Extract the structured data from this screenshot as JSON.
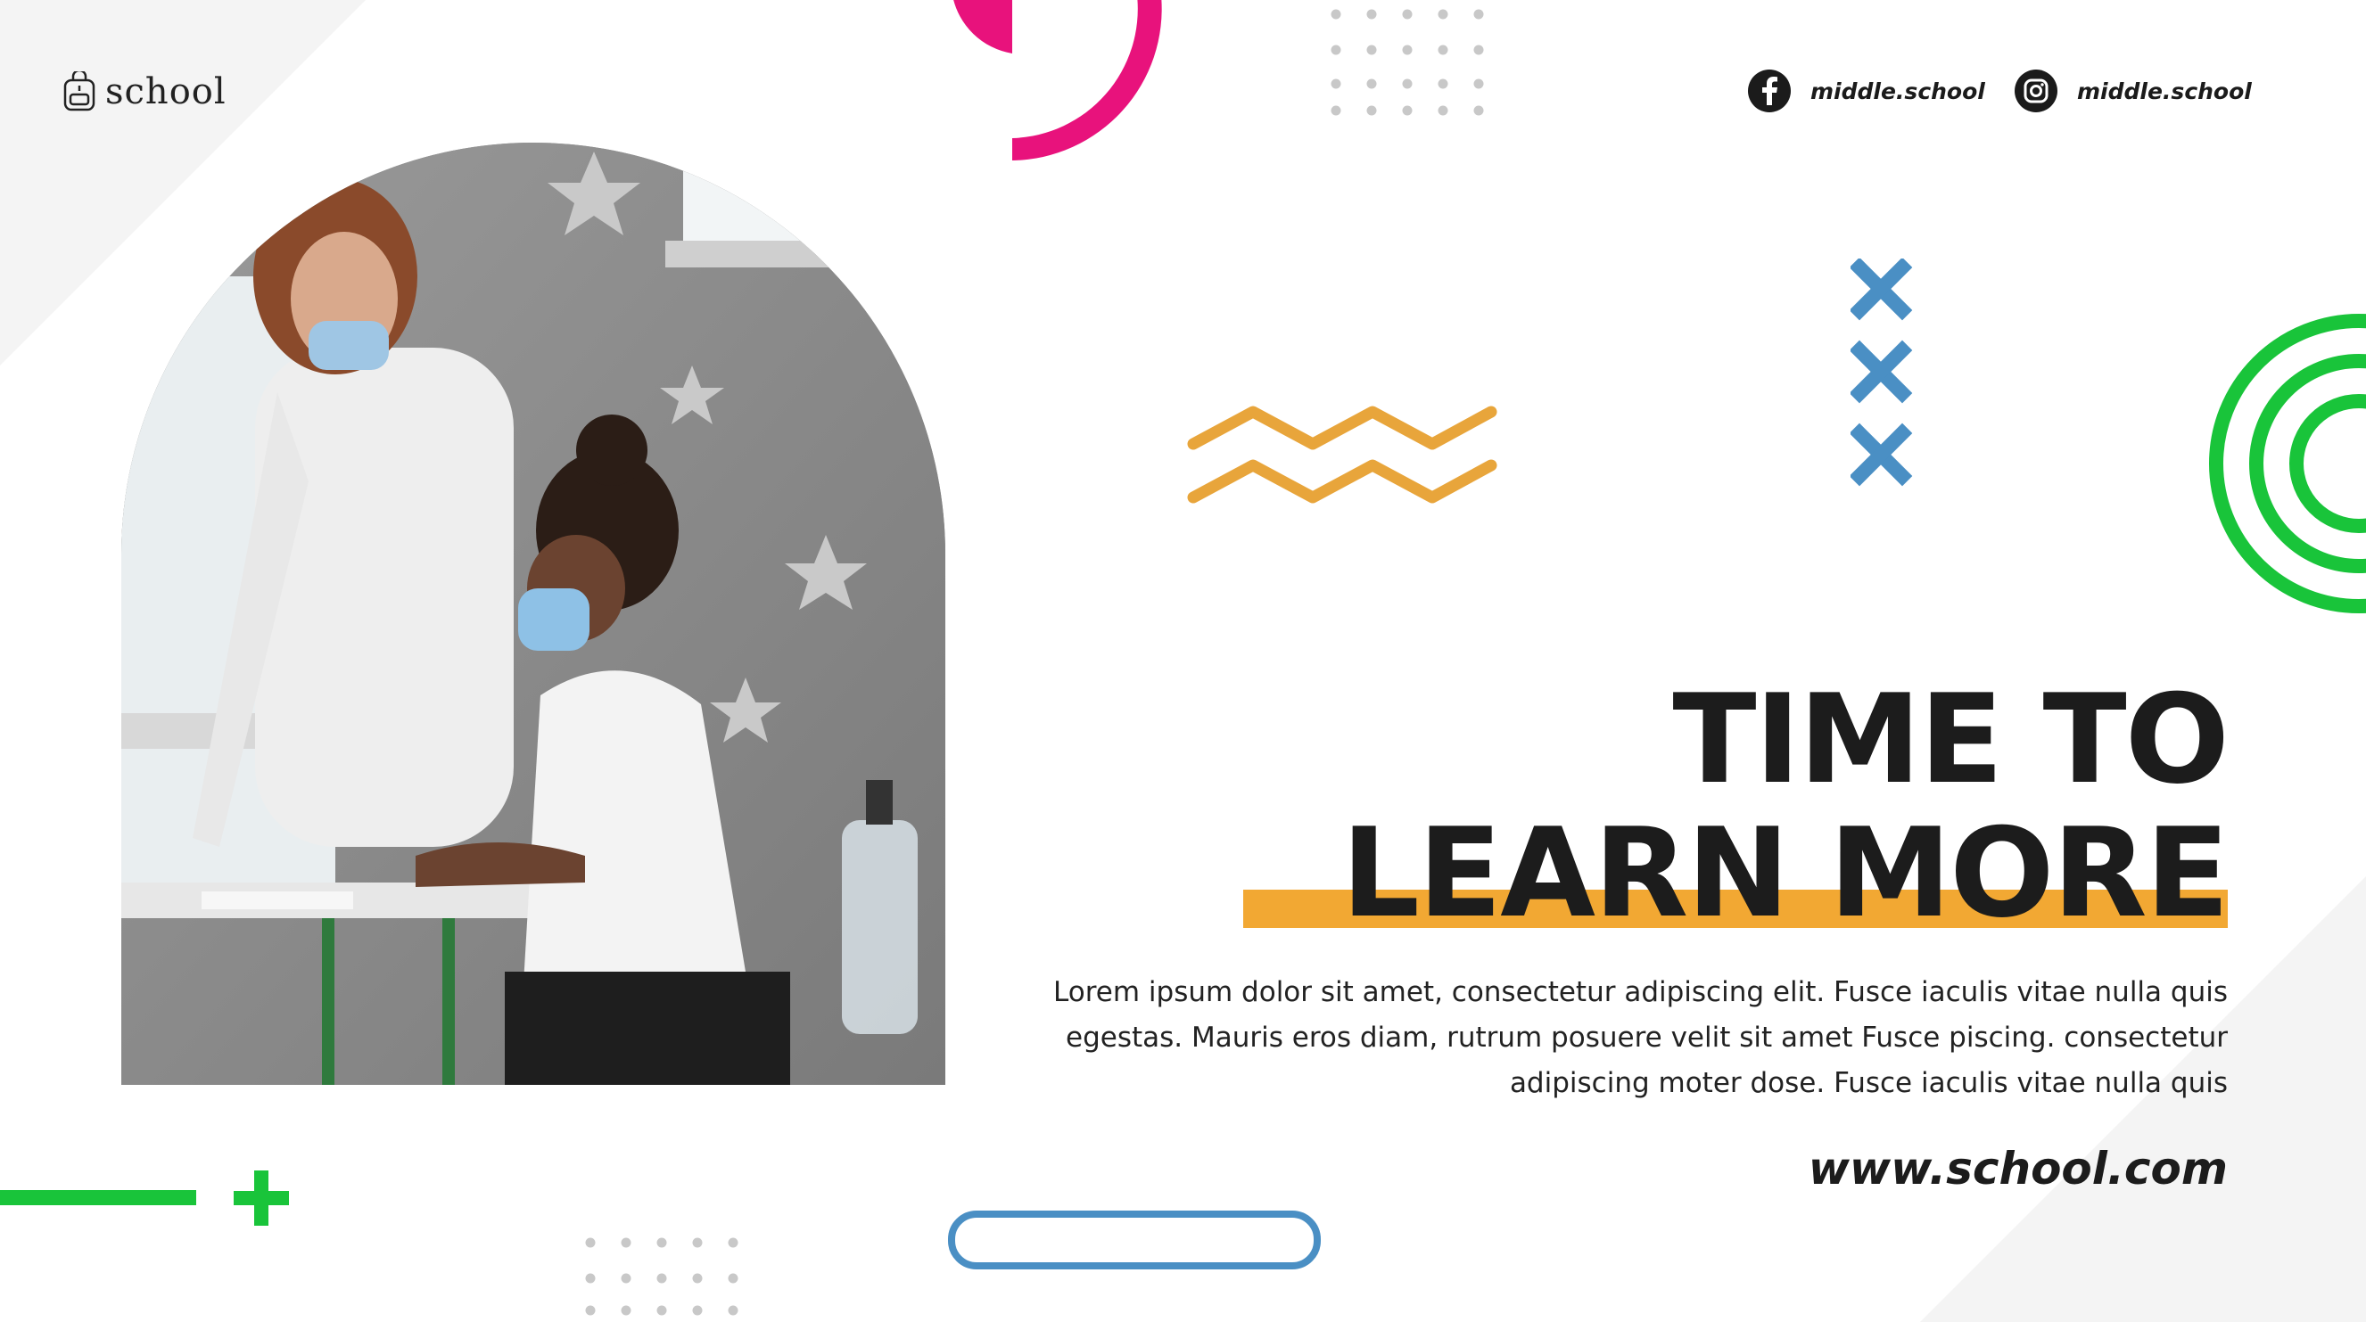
{
  "brand": {
    "logo_text": "school",
    "logo_icon": "backpack-icon"
  },
  "social": [
    {
      "icon": "facebook-icon",
      "handle": "middle.school"
    },
    {
      "icon": "instagram-icon",
      "handle": "middle.school"
    }
  ],
  "photo": {
    "description_icon": "classroom-photo"
  },
  "headline": {
    "line1": "TIME TO",
    "line2": "LEARN MORE"
  },
  "body": "Lorem ipsum dolor sit amet, consectetur adipiscing elit. Fusce iaculis vitae nulla quis egestas. Mauris eros diam, rutrum posuere velit sit amet Fusce piscing. consectetur adipiscing moter dose. Fusce iaculis vitae nulla quis",
  "website": "www.school.com",
  "colors": {
    "accent_orange": "#f2a833",
    "magenta": "#e8127c",
    "green": "#19c43a",
    "blue": "#4a8fc4",
    "dark": "#1c1c1c"
  }
}
